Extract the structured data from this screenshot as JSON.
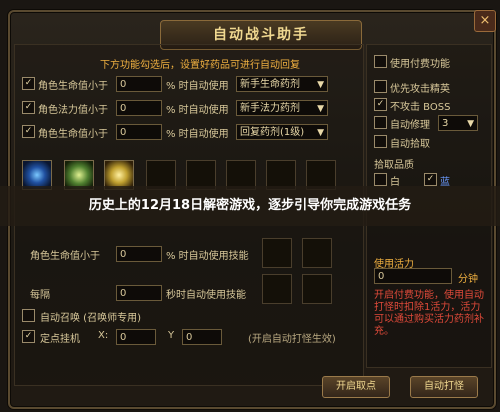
{
  "window": {
    "title": "自动战斗助手",
    "close_label": "×"
  },
  "left": {
    "tip": "下方功能勾选后，设置好药品可进行自动回复",
    "rows": [
      {
        "label": "角色生命值小于",
        "unit": "% 时自动使用",
        "value": "0",
        "item": "新手生命药剂"
      },
      {
        "label": "角色法力值小于",
        "unit": "% 时自动使用",
        "value": "0",
        "item": "新手法力药剂"
      },
      {
        "label": "角色生命值小于",
        "unit": "% 时自动使用",
        "value": "0",
        "item": "回复药剂(1级)"
      }
    ],
    "row2": [
      {
        "label": "角色生命值小于",
        "unit": "% 时自动使用技能",
        "value": "0"
      },
      {
        "label": "每隔",
        "unit": "秒时自动使用技能",
        "value": "0"
      }
    ],
    "auto_summon": "自动召唤 (召唤师专用)",
    "fixed_hang": "定点挂机",
    "x_label": "X:",
    "y_label": "Y",
    "x_value": "0",
    "y_value": "0",
    "hint": "(开启自动打怪生效)"
  },
  "banner": "历史上的12月18日解密游戏，逐步引导你完成游戏任务",
  "right": {
    "use_pay": "使用付费功能",
    "priority_elite": "优先攻击精英",
    "no_boss": "不攻击 BOSS",
    "auto_repair": "自动修理",
    "repair_value": "3",
    "auto_pickup": "自动拾取",
    "pickup_quality": "拾取品质",
    "q_white": "白",
    "q_blue": "蓝",
    "use_mana": "使用活力",
    "mana_value": "0",
    "mana_unit": "分钟",
    "desc": "开启付费功能，使用自动打怪时扣除1活力，活力可以通过购买活力药剂补充。"
  },
  "buttons": {
    "start": "开启取点",
    "auto_fight": "自动打怪"
  }
}
